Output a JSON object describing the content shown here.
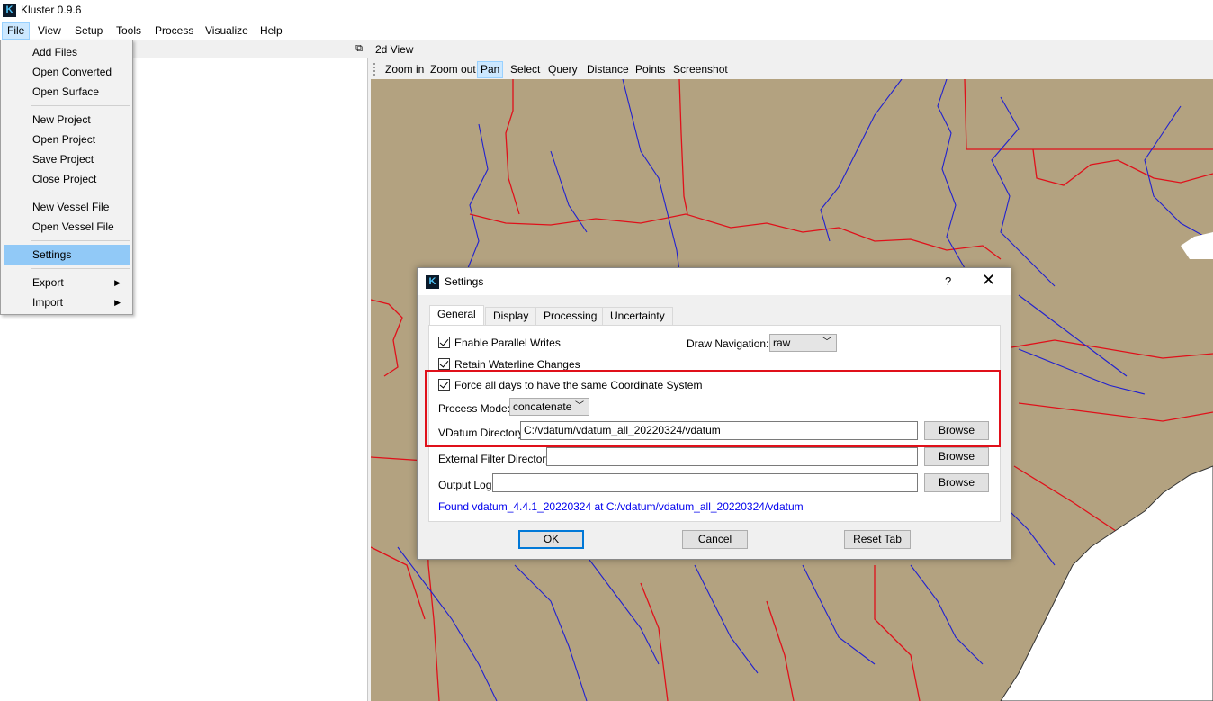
{
  "window": {
    "title": "Kluster 0.9.6",
    "icon": "kluster-app-icon"
  },
  "menubar": {
    "items": [
      "File",
      "View",
      "Setup",
      "Tools",
      "Process",
      "Visualize",
      "Help"
    ],
    "active": "File"
  },
  "file_menu": {
    "items": [
      "Add Files",
      "Open Converted",
      "Open Surface",
      "New Project",
      "Open Project",
      "Save Project",
      "Close Project",
      "New Vessel File",
      "Open Vessel File",
      "Settings",
      "Export",
      "Import"
    ],
    "highlighted": "Settings"
  },
  "view": {
    "title": "2d View",
    "toolbar": [
      "Zoom in",
      "Zoom out",
      "Pan",
      "Select",
      "Query",
      "Distance",
      "Points",
      "Screenshot"
    ],
    "checked_tool": "Pan"
  },
  "dialog": {
    "title": "Settings",
    "help": "?",
    "close": "✕",
    "tabs": [
      "General",
      "Display",
      "Processing",
      "Uncertainty"
    ],
    "active_tab": "General",
    "general": {
      "enable_parallel_writes": "Enable Parallel Writes",
      "retain_waterline": "Retain Waterline Changes",
      "force_coord": "Force all days to have the same Coordinate System",
      "draw_navigation_label": "Draw Navigation:",
      "draw_navigation_value": "raw",
      "process_mode_label": "Process Mode:",
      "process_mode_value": "concatenate",
      "vdatum_label": "VDatum Directory",
      "vdatum_value": "C:/vdatum/vdatum_all_20220324/vdatum",
      "external_filter_label": "External Filter Directory",
      "external_filter_value": "",
      "output_log_label": "Output Log",
      "output_log_value": "",
      "browse": "Browse",
      "found_message": "Found vdatum_4.4.1_20220324 at C:/vdatum/vdatum_all_20220324/vdatum"
    },
    "buttons": {
      "ok": "OK",
      "cancel": "Cancel",
      "reset": "Reset Tab"
    }
  },
  "colors": {
    "map_land": "#b3a280",
    "state_border": "#e0101a",
    "river": "#2020d0",
    "highlight_box": "#e0101a"
  }
}
